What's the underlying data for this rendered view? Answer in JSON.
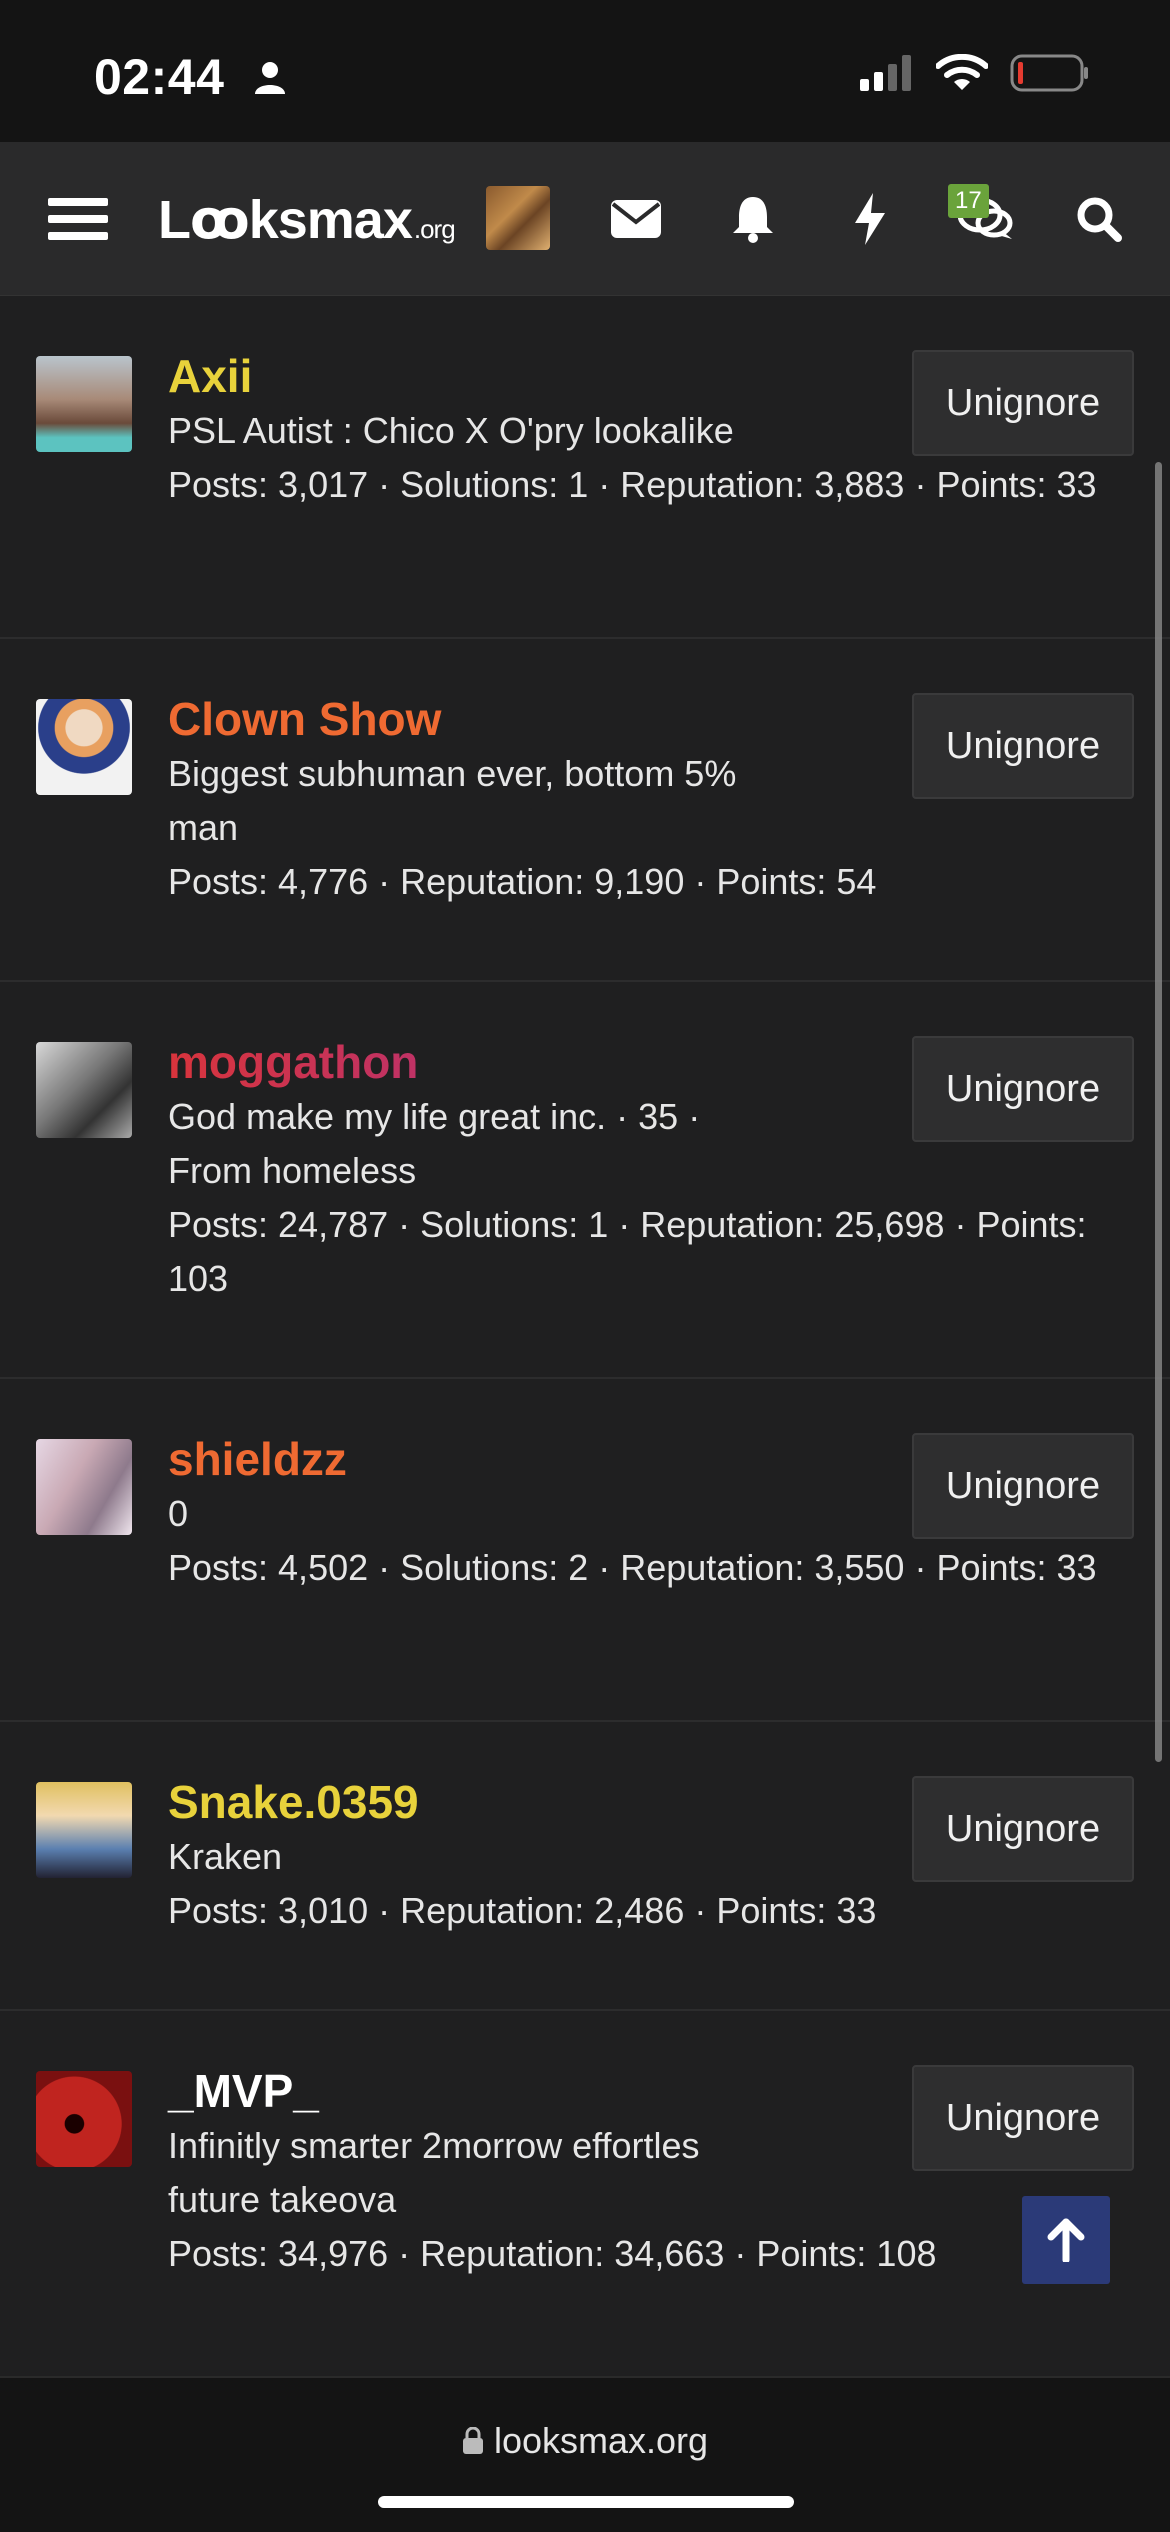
{
  "status": {
    "time": "02:44"
  },
  "nav": {
    "logo_main": "Lꝏksmax",
    "logo_suffix": ".org",
    "conversations_badge": "17"
  },
  "members": [
    {
      "name": "Axii",
      "name_color": "yellow",
      "title": "PSL Autist : Chico X O'pry lookalike",
      "stats": "Posts: 3,017 · Solutions: 1 · Reputation: 3,883 · Points: 33",
      "button": "Unignore"
    },
    {
      "name": "Clown Show",
      "name_color": "orange",
      "title": "Biggest subhuman ever, bottom 5% man",
      "stats": "Posts: 4,776 · Reputation: 9,190 · Points: 54",
      "button": "Unignore"
    },
    {
      "name": "moggathon",
      "name_color": "gradient",
      "title": "God make my life great inc. · 35 · From homeless",
      "stats": "Posts: 24,787 · Solutions: 1 · Reputation: 25,698 · Points: 103",
      "button": "Unignore"
    },
    {
      "name": "shieldzz",
      "name_color": "orange",
      "title": "0",
      "stats": "Posts: 4,502 · Solutions: 2 · Reputation: 3,550 · Points: 33",
      "button": "Unignore"
    },
    {
      "name": "Snake.0359",
      "name_color": "yellow",
      "title": "Kraken",
      "stats": "Posts: 3,010 · Reputation: 2,486 · Points: 33",
      "button": "Unignore"
    },
    {
      "name": "_MVP_",
      "name_color": "white",
      "title": "Infinitly smarter 2morrow effortles future takeova",
      "stats": "Posts: 34,976 · Reputation: 34,663 · Points: 108",
      "button": "Unignore"
    }
  ],
  "url_bar": {
    "url": "looksmax.org"
  },
  "colors": {
    "yellow": "#e8d23b",
    "orange": "#ef6a32",
    "accent_blue": "#2b3a78",
    "badge_green": "#6aa33b"
  }
}
